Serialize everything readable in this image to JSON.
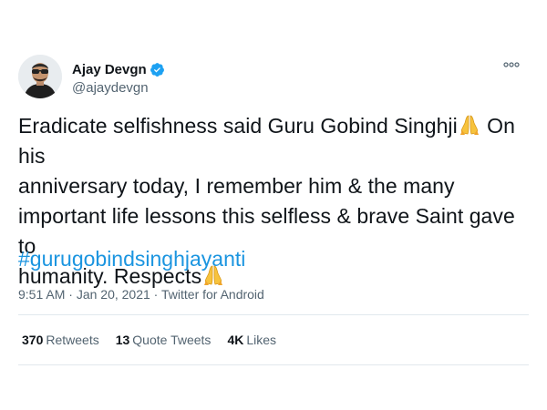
{
  "user": {
    "display_name": "Ajay Devgn",
    "handle": "@ajaydevgn",
    "verified_color": "#1da1f2"
  },
  "tweet": {
    "line1": "Eradicate selfishness said Guru Gobind Singhji",
    "line1b": " On his",
    "line2": "anniversary today, I remember him & the many",
    "line3": "important life lessons this selfless & brave Saint gave to",
    "line4": "humanity. Respects",
    "emoji": "folded-hands",
    "hashtag": "#gurugobindsinghjayanti"
  },
  "meta": {
    "time": "9:51 AM",
    "separator": " · ",
    "date": "Jan 20, 2021",
    "source": "Twitter for Android"
  },
  "stats": {
    "retweets_count": "370",
    "retweets_label": "Retweets",
    "quotes_count": "13",
    "quotes_label": "Quote Tweets",
    "likes_count": "4K",
    "likes_label": "Likes"
  },
  "colors": {
    "link": "#1b95e0",
    "secondary_text": "#536471",
    "primary_text": "#0f1419"
  }
}
